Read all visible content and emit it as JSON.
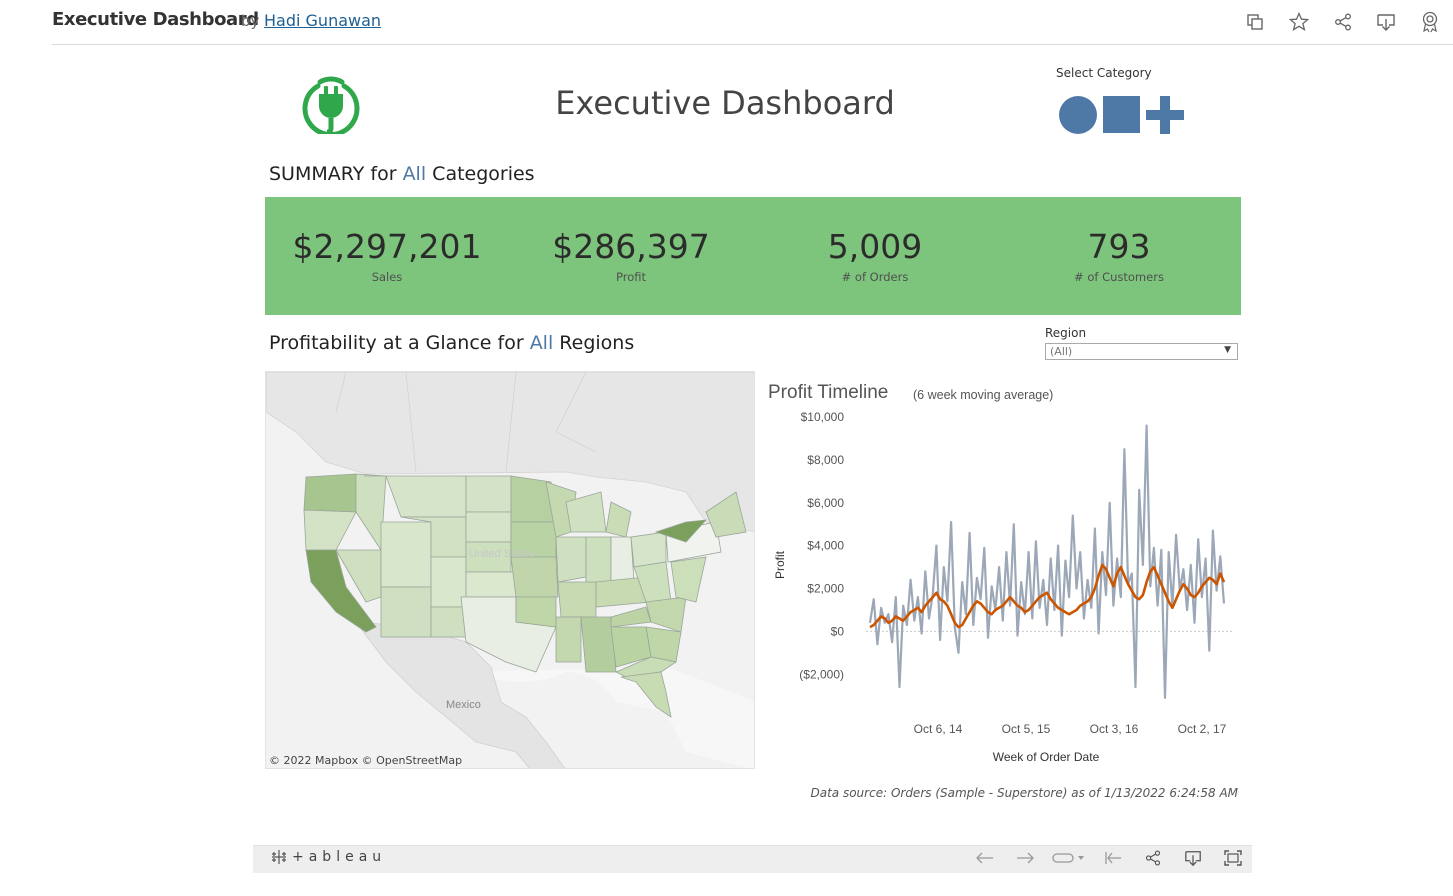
{
  "header": {
    "title": "Executive Dashboard",
    "by": "by",
    "author": "Hadi Gunawan",
    "icons": [
      "copy-icon",
      "star-icon",
      "share-icon",
      "download-icon",
      "badge-icon"
    ]
  },
  "dashboard": {
    "title": "Executive Dashboard",
    "select_category_label": "Select Category",
    "category_shapes": [
      "circle",
      "square",
      "plus"
    ],
    "summary": {
      "prefix": "SUMMARY for",
      "highlight": "All",
      "suffix": "Categories"
    },
    "kpis": [
      {
        "value": "$2,297,201",
        "label": "Sales"
      },
      {
        "value": "$286,397",
        "label": "Profit"
      },
      {
        "value": "5,009",
        "label": "# of Orders"
      },
      {
        "value": "793",
        "label": "# of Customers"
      }
    ],
    "profitability": {
      "prefix": "Profitability at a Glance for",
      "highlight": "All",
      "suffix": "Regions"
    },
    "region": {
      "label": "Region",
      "value": "(All)"
    },
    "map": {
      "labels": [
        "United States",
        "Mexico"
      ],
      "attribution": "© 2022 Mapbox  © OpenStreetMap"
    },
    "data_source": "Data source: Orders (Sample - Superstore) as of 1/13/2022 6:24:58 AM"
  },
  "colors": {
    "kpi_band": "#7dc47c",
    "accent": "#4e79a7",
    "line_raw": "#9ca8b8",
    "line_avg": "#cc5500",
    "logo_green": "#2ea84a"
  },
  "chart_data": {
    "type": "line",
    "title": "Profit Timeline",
    "subtitle": "(6 week moving average)",
    "xlabel": "Week of Order Date",
    "ylabel": "Profit",
    "x_ticks": [
      "Oct 6, 14",
      "Oct 5, 15",
      "Oct 3, 16",
      "Oct 2, 17"
    ],
    "y_ticks": [
      "$10,000",
      "$8,000",
      "$6,000",
      "$4,000",
      "$2,000",
      "$0",
      "($2,000)"
    ],
    "ylim": [
      -2500,
      10000
    ],
    "grid": false,
    "zero_line": true,
    "series": [
      {
        "values": [
          400,
          1500,
          -600,
          1100,
          400,
          800,
          -500,
          1600,
          -2600,
          1200,
          300,
          2400,
          500,
          1600,
          -100,
          2800,
          600,
          1700,
          4000,
          -400,
          3000,
          1400,
          5100,
          200,
          -1000,
          2300,
          800,
          4600,
          300,
          2500,
          1500,
          3900,
          -300,
          2100,
          1000,
          3000,
          500,
          3700,
          1200,
          5000,
          -200,
          2300,
          800,
          3700,
          600,
          4200,
          1100,
          2400,
          300,
          3400,
          1000,
          4000,
          -200,
          3300,
          1600,
          5400,
          2000,
          3700,
          600,
          2400,
          1100,
          4800,
          -100,
          3700,
          1700,
          6000,
          1200,
          3400,
          1600,
          8500,
          2200,
          2700,
          -2600,
          6600,
          3100,
          9600,
          2100,
          3900,
          1200,
          3800,
          -3100,
          3700,
          1200,
          4500,
          1900,
          2900,
          1000,
          3100,
          400,
          4300,
          1600,
          3400,
          -900,
          4700,
          1900,
          3500,
          1300
        ],
        "color": "#9ca8b8"
      },
      {
        "values": [
          200,
          300,
          500,
          700,
          600,
          400,
          500,
          700,
          600,
          500,
          700,
          900,
          1000,
          1100,
          900,
          1200,
          1400,
          1600,
          1800,
          1500,
          1400,
          1200,
          800,
          400,
          200,
          300,
          600,
          900,
          1200,
          1400,
          1300,
          1100,
          900,
          800,
          1000,
          1100,
          1200,
          1400,
          1600,
          1400,
          1200,
          1100,
          900,
          1000,
          1200,
          1400,
          1600,
          1700,
          1800,
          1500,
          1300,
          1100,
          1000,
          900,
          800,
          900,
          1000,
          1200,
          1300,
          1400,
          1600,
          2000,
          2600,
          3100,
          2900,
          2500,
          2100,
          2700,
          3000,
          2600,
          2200,
          1900,
          1600,
          1500,
          1700,
          2300,
          2800,
          3000,
          2600,
          2200,
          1800,
          1400,
          1100,
          1500,
          1900,
          2200,
          2000,
          1700,
          1600,
          1800,
          2100,
          2300,
          2500,
          2400,
          2200,
          2700,
          2300
        ],
        "color": "#cc5500"
      }
    ]
  }
}
